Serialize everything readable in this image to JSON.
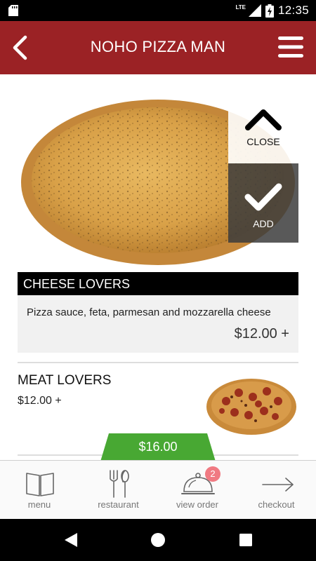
{
  "status_bar": {
    "network": "LTE",
    "time": "12:35"
  },
  "header": {
    "title": "NOHO PIZZA MAN",
    "back_icon": "chevron-left-icon",
    "menu_icon": "hamburger-menu-icon",
    "color": "#9b2225"
  },
  "selected_item": {
    "close_label": "CLOSE",
    "add_label": "ADD",
    "name": "CHEESE LOVERS",
    "description": "Pizza sauce, feta, parmesan and mozzarella cheese",
    "price": "$12.00 +"
  },
  "menu_items": [
    {
      "name": "MEAT LOVERS",
      "price": "$12.00 +"
    }
  ],
  "order_total": "$16.00",
  "bottom_nav": {
    "items": [
      {
        "label": "menu",
        "icon": "book-icon"
      },
      {
        "label": "restaurant",
        "icon": "fork-knife-icon"
      },
      {
        "label": "view order",
        "icon": "cloche-icon",
        "badge": "2"
      },
      {
        "label": "checkout",
        "icon": "arrow-right-icon"
      }
    ]
  },
  "colors": {
    "accent_green": "#48a833",
    "badge": "#f07a82"
  }
}
